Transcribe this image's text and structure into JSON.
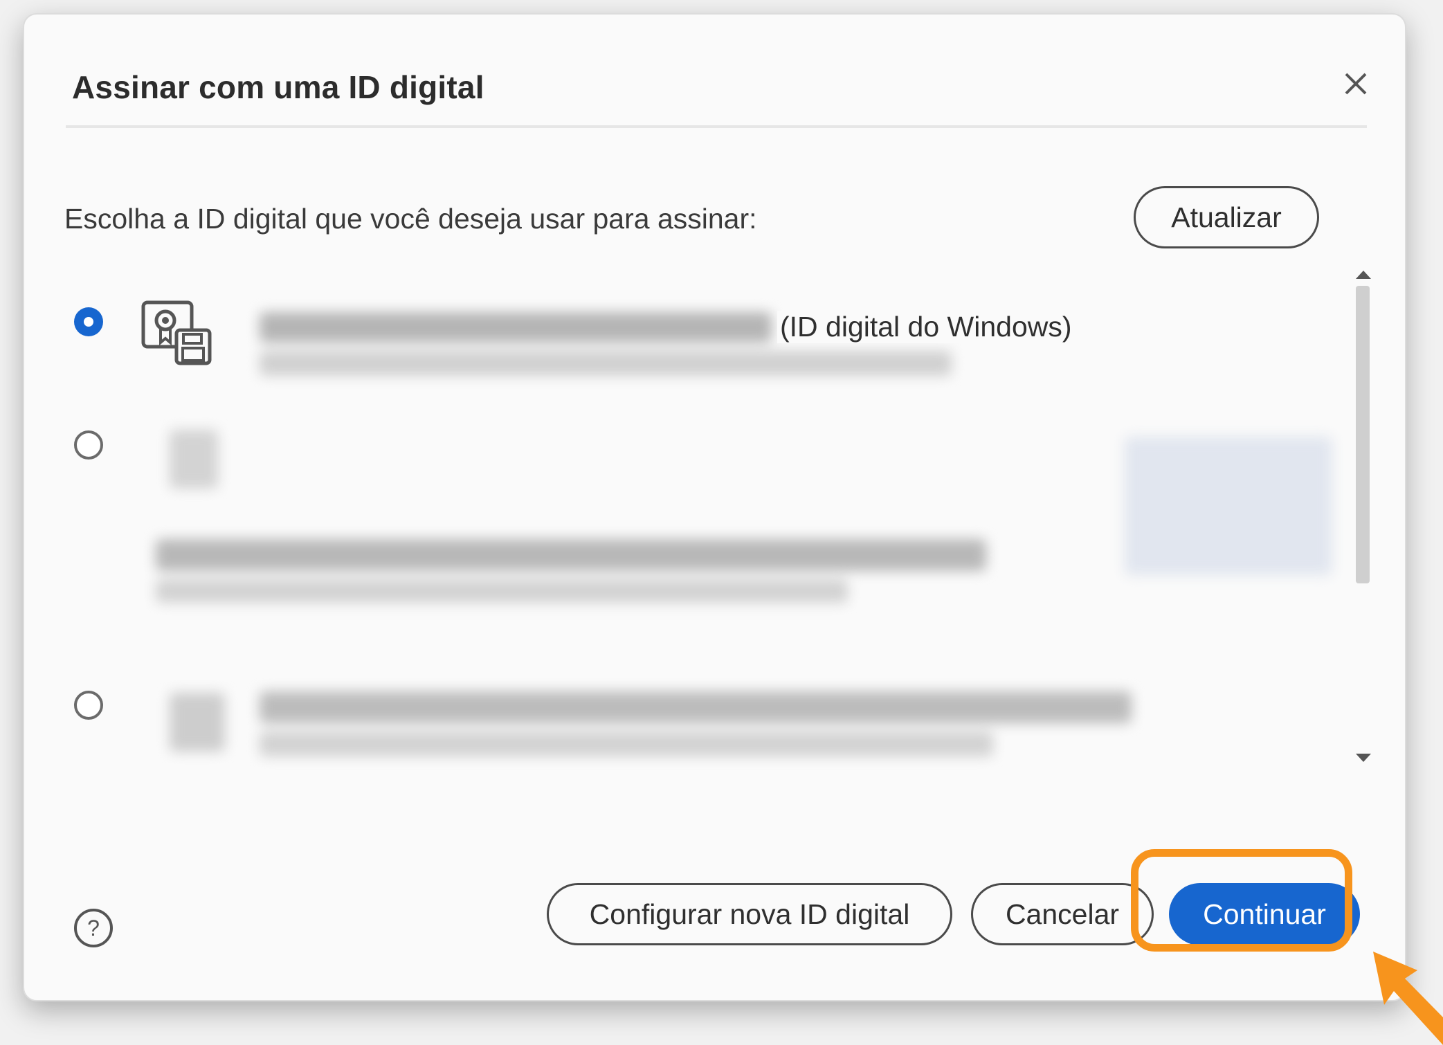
{
  "dialog": {
    "title": "Assinar com uma ID digital",
    "prompt": "Escolha a ID digital que você deseja usar para assinar:",
    "refresh_label": "Atualizar"
  },
  "digital_ids": [
    {
      "selected": true,
      "type_label": "(ID digital do Windows)",
      "icon": "certificate-disk-icon"
    },
    {
      "selected": false,
      "type_label": "",
      "icon": "certificate-icon"
    },
    {
      "selected": false,
      "type_label": "",
      "icon": "certificate-disk-icon"
    }
  ],
  "footer": {
    "configure_label": "Configurar nova ID digital",
    "cancel_label": "Cancelar",
    "continue_label": "Continuar"
  },
  "colors": {
    "primary": "#1766cf",
    "highlight": "#f7941d"
  }
}
